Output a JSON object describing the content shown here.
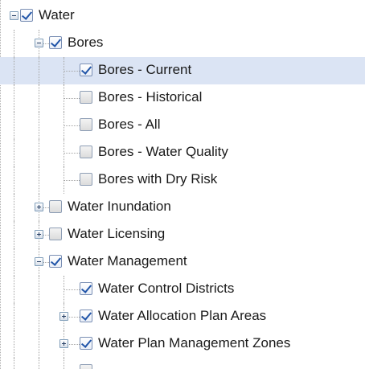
{
  "tree": {
    "nodes": [
      {
        "id": "water",
        "label": "Water",
        "level": 0,
        "expander": "collapse",
        "checked": true,
        "selected": false
      },
      {
        "id": "bores",
        "label": "Bores",
        "level": 1,
        "expander": "collapse",
        "checked": true,
        "selected": false
      },
      {
        "id": "bores-current",
        "label": "Bores - Current",
        "level": 2,
        "expander": "none",
        "checked": true,
        "selected": true
      },
      {
        "id": "bores-historical",
        "label": "Bores - Historical",
        "level": 2,
        "expander": "none",
        "checked": false,
        "selected": false
      },
      {
        "id": "bores-all",
        "label": "Bores - All",
        "level": 2,
        "expander": "none",
        "checked": false,
        "selected": false
      },
      {
        "id": "bores-water-quality",
        "label": "Bores - Water Quality",
        "level": 2,
        "expander": "none",
        "checked": false,
        "selected": false
      },
      {
        "id": "bores-dry-risk",
        "label": "Bores with Dry Risk",
        "level": 2,
        "expander": "none",
        "checked": false,
        "selected": false
      },
      {
        "id": "water-inundation",
        "label": "Water Inundation",
        "level": 1,
        "expander": "expand",
        "checked": false,
        "selected": false
      },
      {
        "id": "water-licensing",
        "label": "Water Licensing",
        "level": 1,
        "expander": "expand",
        "checked": false,
        "selected": false
      },
      {
        "id": "water-management",
        "label": "Water Management",
        "level": 1,
        "expander": "collapse",
        "checked": true,
        "selected": false
      },
      {
        "id": "water-control-districts",
        "label": "Water Control Districts",
        "level": 2,
        "expander": "none",
        "checked": true,
        "selected": false
      },
      {
        "id": "water-allocation-plan-areas",
        "label": "Water Allocation Plan Areas",
        "level": 2,
        "expander": "expand",
        "checked": true,
        "selected": false
      },
      {
        "id": "water-plan-management-zones",
        "label": "Water Plan Management Zones",
        "level": 2,
        "expander": "expand",
        "checked": true,
        "selected": false
      },
      {
        "id": "water-next-item",
        "label": "",
        "level": 2,
        "expander": "none",
        "checked": false,
        "selected": false
      }
    ]
  },
  "colors": {
    "selection": "#dbe4f4",
    "check_mark": "#2155a8",
    "tree_line": "#a5a5a5"
  }
}
